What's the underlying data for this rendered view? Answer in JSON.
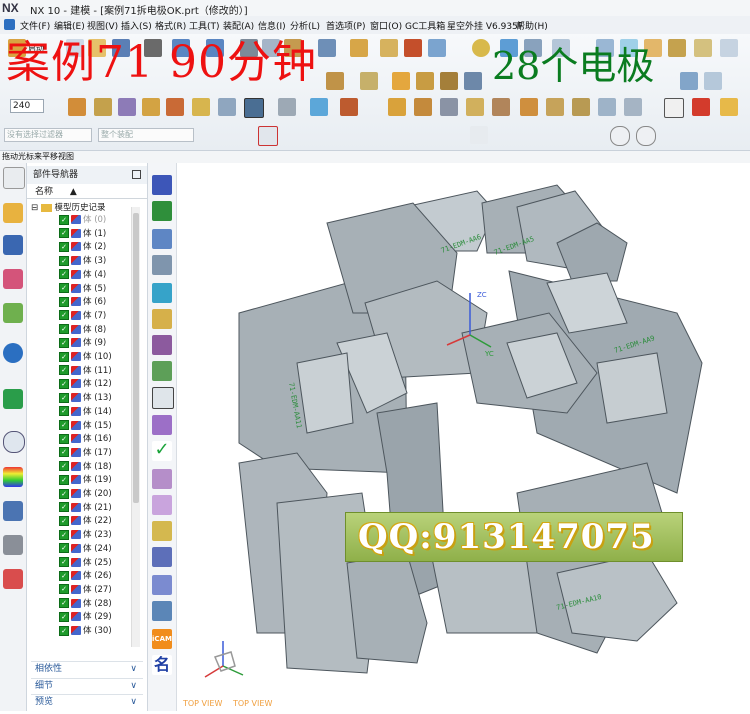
{
  "window": {
    "app_logo": "NX",
    "title": "NX 10 - 建模 - [案例71拆电极OK.prt（修改的）]"
  },
  "menu": [
    "文件(F)",
    "编辑(E)",
    "视图(V)",
    "插入(S)",
    "格式(R)",
    "工具(T)",
    "装配(A)",
    "信息(I)",
    "分析(L)",
    "首选项(P)",
    "窗口(O)",
    "GC工具箱",
    "星空外挂 V6.935F",
    "帮助(H)"
  ],
  "toolbar": {
    "start_label": "启动",
    "zoom_value": "240",
    "filter_placeholder": "没有选择过滤器",
    "assembly_placeholder": "整个装配"
  },
  "overlay": {
    "title": "案例71 90分钟",
    "count": "28个电极",
    "qq": "QQ:913147075"
  },
  "hint": "拖动光标来平移视图",
  "navigator": {
    "title": "部件导航器",
    "column_name": "名称",
    "root": "模型历史记录",
    "items": [
      {
        "label": "体 (0)",
        "gray": true
      },
      {
        "label": "体 (1)"
      },
      {
        "label": "体 (2)"
      },
      {
        "label": "体 (3)"
      },
      {
        "label": "体 (4)"
      },
      {
        "label": "体 (5)"
      },
      {
        "label": "体 (6)"
      },
      {
        "label": "体 (7)"
      },
      {
        "label": "体 (8)"
      },
      {
        "label": "体 (9)"
      },
      {
        "label": "体 (10)"
      },
      {
        "label": "体 (11)"
      },
      {
        "label": "体 (12)"
      },
      {
        "label": "体 (13)"
      },
      {
        "label": "体 (14)"
      },
      {
        "label": "体 (15)"
      },
      {
        "label": "体 (16)"
      },
      {
        "label": "体 (17)"
      },
      {
        "label": "体 (18)"
      },
      {
        "label": "体 (19)"
      },
      {
        "label": "体 (20)"
      },
      {
        "label": "体 (21)"
      },
      {
        "label": "体 (22)"
      },
      {
        "label": "体 (23)"
      },
      {
        "label": "体 (24)"
      },
      {
        "label": "体 (25)"
      },
      {
        "label": "体 (26)"
      },
      {
        "label": "体 (27)"
      },
      {
        "label": "体 (28)"
      },
      {
        "label": "体 (29)"
      },
      {
        "label": "体 (30)"
      }
    ],
    "panels": [
      "相依性",
      "细节",
      "预览"
    ]
  },
  "vertical_toolbar": {
    "icam_label": "iCAM",
    "name_label": "名"
  },
  "viewport": {
    "view_labels": [
      "TOP VIEW",
      "TOP VIEW"
    ],
    "axis_labels": [
      "ZC",
      "YC",
      "XC"
    ],
    "part_color": "#a7b0b6"
  }
}
